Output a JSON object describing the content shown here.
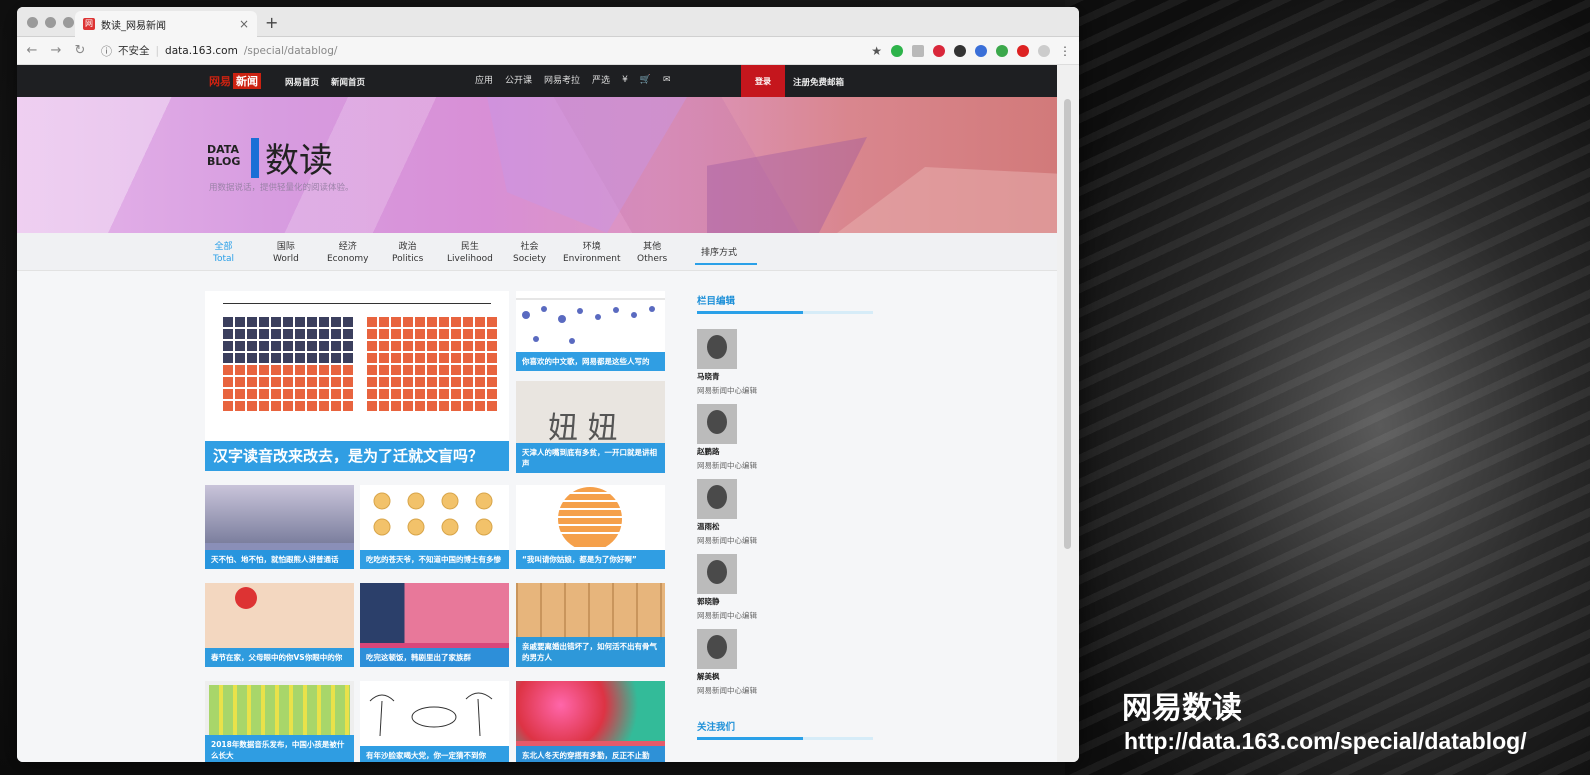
{
  "browser": {
    "tab_title": "数读_网易新闻",
    "tab_favicon": "网",
    "new_tab": "+",
    "address_security": "不安全",
    "address_host": "data.163.com",
    "address_path": "/special/datablog/"
  },
  "topnav": {
    "logo_brand": "网易",
    "logo_news": "新闻",
    "link1": "网易首页",
    "link2": "新闻首页",
    "items": [
      "应用",
      "公开课",
      "网易考拉",
      "严选",
      "¥",
      "🛒",
      "✉"
    ],
    "login": "登录",
    "register": "注册免费邮箱"
  },
  "banner": {
    "logo_text_1": "DATA",
    "logo_text_2": "BLOG",
    "title": "数读",
    "subtitle": "用数据说话，提供轻量化的阅读体验。"
  },
  "categories": [
    {
      "zh": "全部",
      "en": "Total"
    },
    {
      "zh": "国际",
      "en": "World"
    },
    {
      "zh": "经济",
      "en": "Economy"
    },
    {
      "zh": "政治",
      "en": "Politics"
    },
    {
      "zh": "民生",
      "en": "Livelihood"
    },
    {
      "zh": "社会",
      "en": "Society"
    },
    {
      "zh": "环境",
      "en": "Environment"
    },
    {
      "zh": "其他",
      "en": "Others"
    }
  ],
  "sort_label": "排序方式",
  "articles": {
    "big": "汉字读音改来改去，是为了迁就文盲吗？",
    "a1": "你喜欢的中文歌，网易都是这些人写的",
    "a2": "天津人的嘴到底有多贫，一开口就是讲相声",
    "a3": "天不怕、地不怕，就怕跟熊人讲普通话",
    "a4": "吃吃的苍天爷，不知道中国的博士有多惨",
    "a5": "“我叫请你姑娘，都是为了你好啊”",
    "a6": "春节在家，父母眼中的你VS你眼中的你",
    "a7": "吃完这顿饭，韩剧里出了家族群",
    "a8": "亲戚要离婚出错坏了，如何活不出有骨气的男方人",
    "a9": "2018年数据音乐发布，中国小孩是被什么长大",
    "a10": "有年沙脸家喝大党，你一定猜不到你",
    "a11": "东北人冬天的穿搭有多勤，反正不止勤"
  },
  "sidebar": {
    "editors_title": "栏目编辑",
    "editors": [
      {
        "name": "马晓青",
        "role": "网易新闻中心编辑"
      },
      {
        "name": "赵鹏路",
        "role": "网易新闻中心编辑"
      },
      {
        "name": "温雨松",
        "role": "网易新闻中心编辑"
      },
      {
        "name": "郭晓静",
        "role": "网易新闻中心编辑"
      },
      {
        "name": "解美枫",
        "role": "网易新闻中心编辑"
      }
    ],
    "follow_title": "关注我们"
  },
  "overlay": {
    "title": "网易数读",
    "url": "http://data.163.com/special/datablog/"
  },
  "colors": {
    "accent": "#2aa0e8",
    "brand_red": "#c5161d",
    "nav_dark": "#1e1f22"
  }
}
